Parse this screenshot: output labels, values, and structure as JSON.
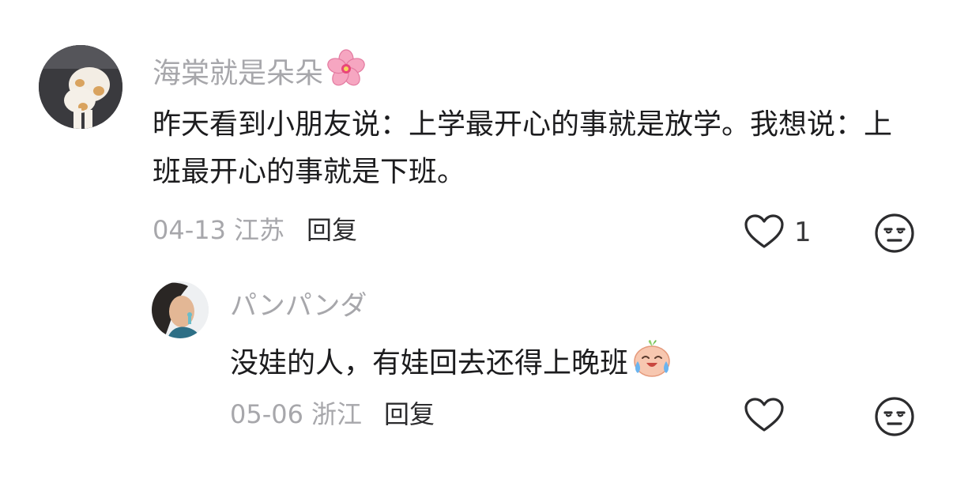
{
  "comments": [
    {
      "username": "海棠就是朵朵",
      "username_emoji": "cherry-blossom-icon",
      "text": "昨天看到小朋友说：上学最开心的事就是放学。我想说：上班最开心的事就是下班。",
      "date": "04-13",
      "location": "江苏",
      "reply_label": "回复",
      "like_count": "1"
    }
  ],
  "replies": [
    {
      "username": "パンパンダ",
      "text": "没娃的人，有娃回去还得上晚班",
      "text_emoji": "laughing-crying-icon",
      "date": "05-06",
      "location": "浙江",
      "reply_label": "回复"
    }
  ],
  "colors": {
    "username": "#a7a7ab",
    "text": "#1c1c1e",
    "meta": "#a7a7ab",
    "reply_button": "#2c2c2e",
    "icon_stroke": "#2c2c2e"
  }
}
